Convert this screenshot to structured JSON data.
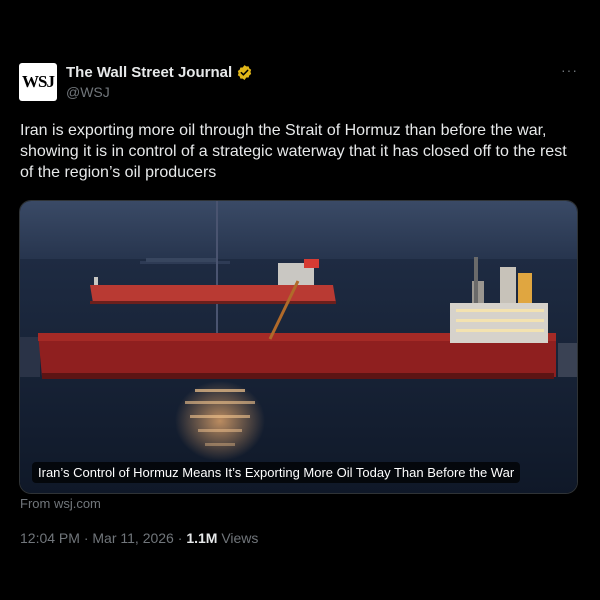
{
  "author": {
    "logo_text": "WSJ",
    "display_name": "The Wall Street Journal",
    "handle": "@WSJ",
    "verified_color": "#e2b719"
  },
  "menu": {
    "more_label": "···"
  },
  "post": {
    "text": "Iran is exporting more oil through the Strait of Hormuz than before the war, showing it is in control of a strategic waterway that it has closed off to the rest of the region’s oil producers"
  },
  "link_card": {
    "headline": "Iran’s Control of Hormuz Means It’s Exporting More Oil Today Than Before the War",
    "source": "From wsj.com"
  },
  "meta": {
    "time": "12:04 PM",
    "separator": "·",
    "date": "Mar 11, 2026",
    "views_count": "1.1M",
    "views_label": "Views"
  }
}
